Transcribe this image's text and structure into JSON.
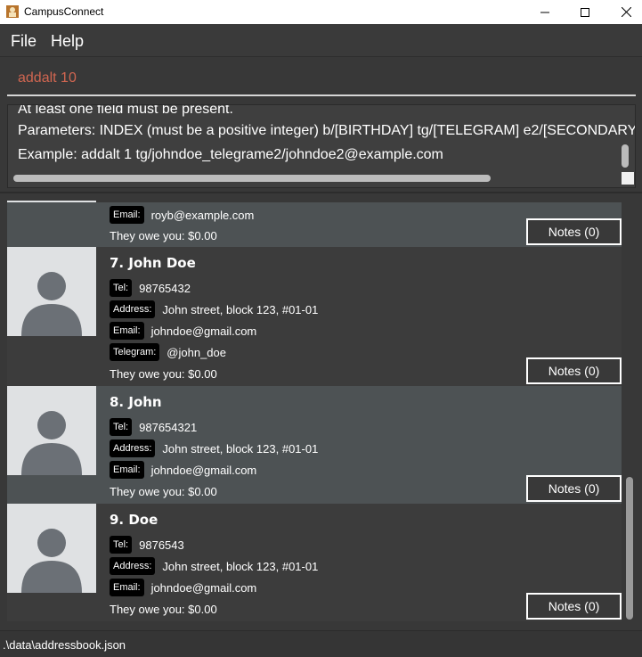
{
  "window": {
    "title": "CampusConnect",
    "icon": "app-icon"
  },
  "menu": {
    "file": "File",
    "help": "Help"
  },
  "command": {
    "value": "addalt 10"
  },
  "result": {
    "lines": [
      "At least one field must be present.",
      "Parameters: INDEX (must be a positive integer) b/[BIRTHDAY] tg/[TELEGRAM] e2/[SECONDARY",
      "Example: addalt 1 tg/johndoe_telegrame2/johndoe2@example.com"
    ]
  },
  "contacts": [
    {
      "title": "",
      "fields": [
        {
          "tag": "Email:",
          "value": "royb@example.com"
        }
      ],
      "owe": "They owe you: $0.00",
      "notes": "Notes (0)"
    },
    {
      "title": "7.  John Doe",
      "fields": [
        {
          "tag": "Tel:",
          "value": "98765432"
        },
        {
          "tag": "Address:",
          "value": "John street, block 123, #01-01"
        },
        {
          "tag": "Email:",
          "value": "johndoe@gmail.com"
        },
        {
          "tag": "Telegram:",
          "value": "@john_doe"
        }
      ],
      "owe": "They owe you: $0.00",
      "notes": "Notes (0)"
    },
    {
      "title": "8.  John",
      "fields": [
        {
          "tag": "Tel:",
          "value": "987654321"
        },
        {
          "tag": "Address:",
          "value": "John street, block 123, #01-01"
        },
        {
          "tag": "Email:",
          "value": "johndoe@gmail.com"
        }
      ],
      "owe": "They owe you: $0.00",
      "notes": "Notes (0)"
    },
    {
      "title": "9.  Doe",
      "fields": [
        {
          "tag": "Tel:",
          "value": "9876543"
        },
        {
          "tag": "Address:",
          "value": "John street, block 123, #01-01"
        },
        {
          "tag": "Email:",
          "value": "johndoe@gmail.com"
        }
      ],
      "owe": "They owe you: $0.00",
      "notes": "Notes (0)"
    }
  ],
  "status": {
    "path": ".\\data\\addressbook.json"
  },
  "colors": {
    "command_text": "#d06651",
    "card_light": "#4d5254",
    "card_dark": "#3c3c3c"
  }
}
